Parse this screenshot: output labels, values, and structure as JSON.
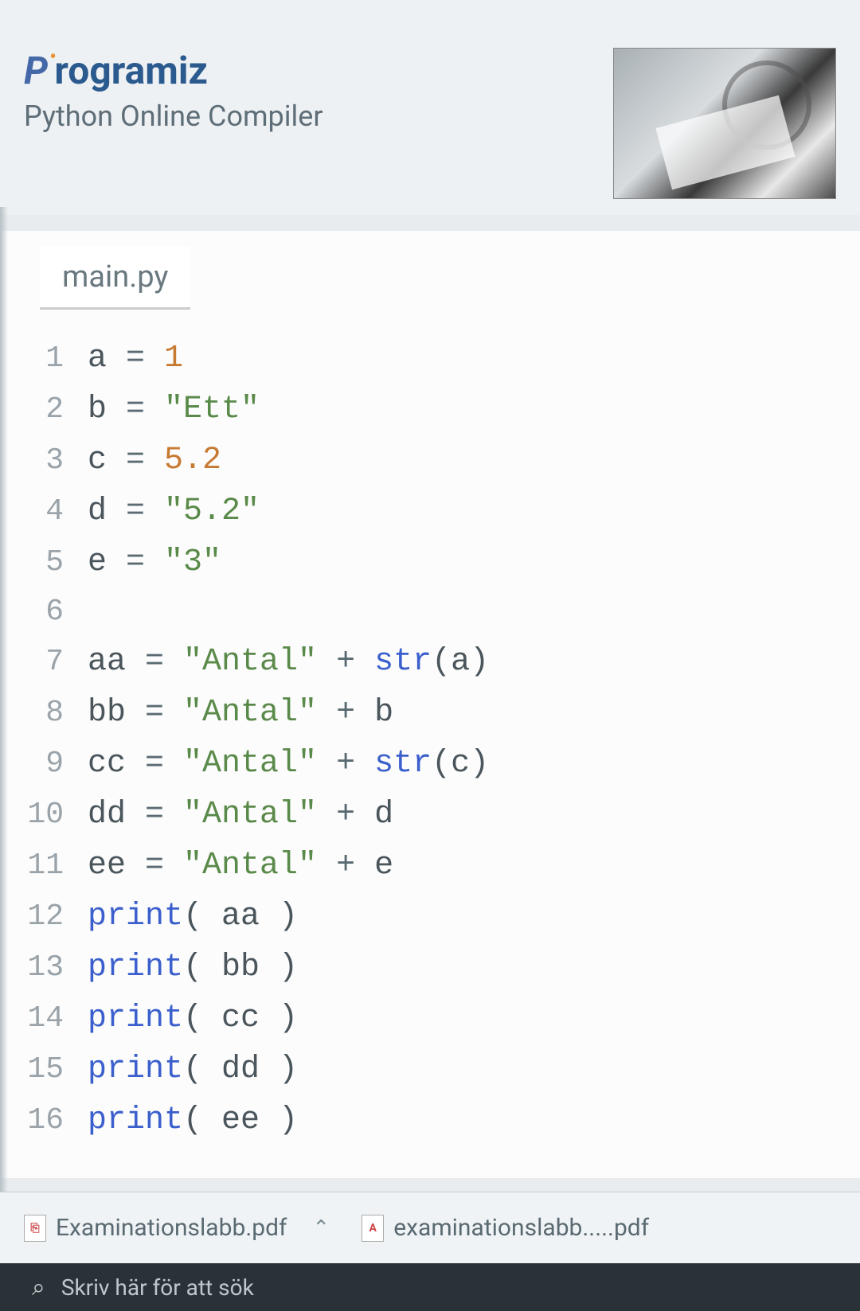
{
  "brand": {
    "name": "Programiz",
    "subtitle": "Python Online Compiler"
  },
  "editor": {
    "tab_label": "main.py",
    "lines": [
      {
        "n": "1",
        "tokens": [
          {
            "t": "a ",
            "c": "var"
          },
          {
            "t": "= ",
            "c": "op"
          },
          {
            "t": "1",
            "c": "num"
          }
        ]
      },
      {
        "n": "2",
        "tokens": [
          {
            "t": "b ",
            "c": "var"
          },
          {
            "t": "= ",
            "c": "op"
          },
          {
            "t": "\"Ett\"",
            "c": "str"
          }
        ]
      },
      {
        "n": "3",
        "tokens": [
          {
            "t": "c ",
            "c": "var"
          },
          {
            "t": "= ",
            "c": "op"
          },
          {
            "t": "5.2",
            "c": "num"
          }
        ]
      },
      {
        "n": "4",
        "tokens": [
          {
            "t": "d ",
            "c": "var"
          },
          {
            "t": "= ",
            "c": "op"
          },
          {
            "t": "\"5.2\"",
            "c": "str"
          }
        ]
      },
      {
        "n": "5",
        "tokens": [
          {
            "t": "e ",
            "c": "var"
          },
          {
            "t": "= ",
            "c": "op"
          },
          {
            "t": "\"3\"",
            "c": "str"
          }
        ]
      },
      {
        "n": "6",
        "tokens": []
      },
      {
        "n": "7",
        "tokens": [
          {
            "t": "aa ",
            "c": "var"
          },
          {
            "t": "= ",
            "c": "op"
          },
          {
            "t": "\"Antal\"",
            "c": "str"
          },
          {
            "t": " + ",
            "c": "op"
          },
          {
            "t": "str",
            "c": "fn"
          },
          {
            "t": "(a)",
            "c": "var"
          }
        ]
      },
      {
        "n": "8",
        "tokens": [
          {
            "t": "bb ",
            "c": "var"
          },
          {
            "t": "= ",
            "c": "op"
          },
          {
            "t": "\"Antal\"",
            "c": "str"
          },
          {
            "t": " + ",
            "c": "op"
          },
          {
            "t": "b",
            "c": "var"
          }
        ]
      },
      {
        "n": "9",
        "tokens": [
          {
            "t": "cc ",
            "c": "var"
          },
          {
            "t": "= ",
            "c": "op"
          },
          {
            "t": "\"Antal\"",
            "c": "str"
          },
          {
            "t": " + ",
            "c": "op"
          },
          {
            "t": "str",
            "c": "fn"
          },
          {
            "t": "(c)",
            "c": "var"
          }
        ]
      },
      {
        "n": "10",
        "tokens": [
          {
            "t": "dd ",
            "c": "var"
          },
          {
            "t": "= ",
            "c": "op"
          },
          {
            "t": "\"Antal\"",
            "c": "str"
          },
          {
            "t": " + ",
            "c": "op"
          },
          {
            "t": "d",
            "c": "var"
          }
        ]
      },
      {
        "n": "11",
        "tokens": [
          {
            "t": "ee ",
            "c": "var"
          },
          {
            "t": "= ",
            "c": "op"
          },
          {
            "t": "\"Antal\"",
            "c": "str"
          },
          {
            "t": " + ",
            "c": "op"
          },
          {
            "t": "e",
            "c": "var"
          }
        ]
      },
      {
        "n": "12",
        "tokens": [
          {
            "t": "print",
            "c": "fn"
          },
          {
            "t": "( aa )",
            "c": "var"
          }
        ]
      },
      {
        "n": "13",
        "tokens": [
          {
            "t": "print",
            "c": "fn"
          },
          {
            "t": "( bb )",
            "c": "var"
          }
        ]
      },
      {
        "n": "14",
        "tokens": [
          {
            "t": "print",
            "c": "fn"
          },
          {
            "t": "( cc )",
            "c": "var"
          }
        ]
      },
      {
        "n": "15",
        "tokens": [
          {
            "t": "print",
            "c": "fn"
          },
          {
            "t": "( dd )",
            "c": "var"
          }
        ]
      },
      {
        "n": "16",
        "tokens": [
          {
            "t": "print",
            "c": "fn"
          },
          {
            "t": "( ee )",
            "c": "var"
          }
        ]
      }
    ]
  },
  "downloads": {
    "items": [
      {
        "name": "Examinationslabb.pdf"
      },
      {
        "name": "examinationslabb.....pdf"
      }
    ]
  },
  "taskbar": {
    "search_placeholder": "Skriv här för att sök"
  }
}
